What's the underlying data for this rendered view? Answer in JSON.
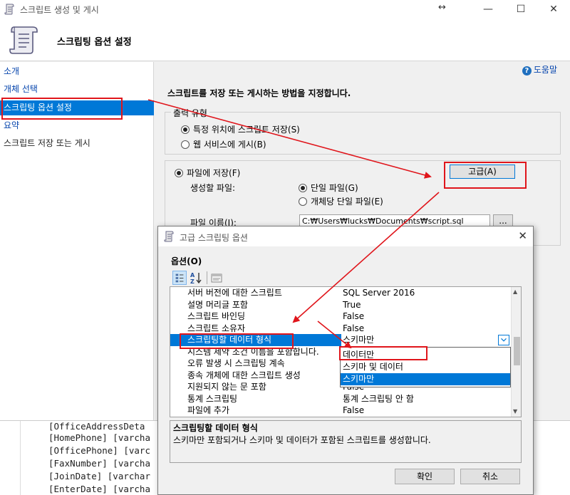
{
  "window": {
    "title": "스크립트 생성 및 게시",
    "move_glyph": "↔",
    "min_glyph": "—",
    "max_glyph": "☐",
    "close_glyph": "✕"
  },
  "header": {
    "title": "스크립팅 옵션 설정"
  },
  "nav": {
    "items": [
      {
        "label": "소개"
      },
      {
        "label": "개체 선택"
      },
      {
        "label": "스크립팅 옵션 설정"
      },
      {
        "label": "요약"
      },
      {
        "label": "스크립트 저장 또는 게시"
      }
    ]
  },
  "content": {
    "help_label": "도움말",
    "help_glyph": "?",
    "instruction": "스크립트를 저장 또는 게시하는 방법을 지정합니다.",
    "output_type": {
      "legend": "출력 유형",
      "option_save": "특정 위치에 스크립트 저장(S)",
      "option_publish": "웹 서비스에 게시(B)"
    },
    "save_to_file": "파일에 저장(F)",
    "advanced_button": "고급(A)",
    "files_to_generate_label": "생성할 파일:",
    "single_file": "단일 파일(G)",
    "file_per_object": "개체당 단일 파일(E)",
    "file_name_label": "파일 이름(I):",
    "file_path": "C:₩Users₩lucks₩Documents₩script.sql",
    "browse_label": "..."
  },
  "code_lines": [
    "[OfficeAddressDeta",
    "[HomePhone] [varcha",
    "[OfficePhone] [varc",
    "[FaxNumber] [varcha",
    "[JoinDate] [varchar",
    "[EnterDate] [varcha"
  ],
  "dialog": {
    "title": "고급 스크립팅 옵션",
    "close_glyph": "✕",
    "options_label": "옵션(O)",
    "rows": [
      {
        "key": "서버 버전에 대한 스크립트",
        "value": "SQL Server 2016"
      },
      {
        "key": "설명 머리글 포함",
        "value": "True"
      },
      {
        "key": "스크립트 바인딩",
        "value": "False"
      },
      {
        "key": "스크립트 소유자",
        "value": "False"
      },
      {
        "key": "스크립팅할 데이터 형식",
        "value": "스키마만"
      },
      {
        "key": "시스템 제약 조건 이름을 포함합니다.",
        "value": ""
      },
      {
        "key": "오류 발생 시 스크립팅 계속",
        "value": ""
      },
      {
        "key": "종속 개체에 대한 스크립트 생성",
        "value": ""
      },
      {
        "key": "지원되지 않는 문 포함",
        "value": "False"
      },
      {
        "key": "통계 스크립팅",
        "value": "통계 스크립팅 안 함"
      },
      {
        "key": "파일에 추가",
        "value": "False"
      }
    ],
    "dropdown_options": [
      "데이터만",
      "스키마 및 데이터",
      "스키마만"
    ],
    "description_title": "스크립팅할 데이터 형식",
    "description_text": "스키마만 포함되거나 스키마 및 데이터가 포함된 스크립트를 생성합니다.",
    "ok_label": "확인",
    "cancel_label": "취소"
  },
  "colors": {
    "accent": "#0078d7",
    "annotation": "#e0151b"
  }
}
